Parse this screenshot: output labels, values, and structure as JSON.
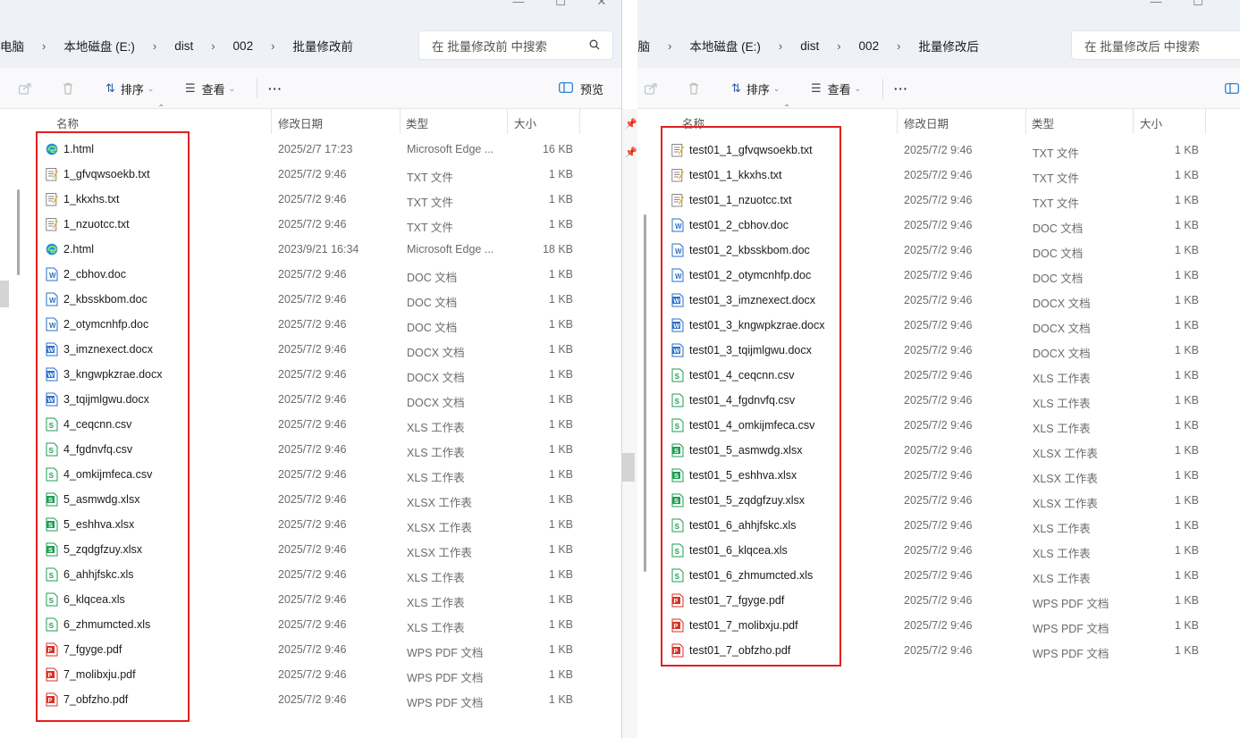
{
  "left": {
    "breadcrumb": [
      "电脑",
      "本地磁盘 (E:)",
      "dist",
      "002",
      "批量修改前"
    ],
    "search_placeholder": "在 批量修改前 中搜索",
    "toolbar": {
      "sort": "排序",
      "view": "查看",
      "more": "···",
      "preview": "预览"
    },
    "columns": {
      "name": "名称",
      "date": "修改日期",
      "type": "类型",
      "size": "大小"
    },
    "rows": [
      {
        "name": "1.html",
        "date": "2025/2/7 17:23",
        "type": "Microsoft Edge ...",
        "size": "16 KB",
        "icon": "edge"
      },
      {
        "name": "1_gfvqwsoekb.txt",
        "date": "2025/7/2 9:46",
        "type": "TXT 文件",
        "size": "1 KB",
        "icon": "txt"
      },
      {
        "name": "1_kkxhs.txt",
        "date": "2025/7/2 9:46",
        "type": "TXT 文件",
        "size": "1 KB",
        "icon": "txt"
      },
      {
        "name": "1_nzuotcc.txt",
        "date": "2025/7/2 9:46",
        "type": "TXT 文件",
        "size": "1 KB",
        "icon": "txt"
      },
      {
        "name": "2.html",
        "date": "2023/9/21 16:34",
        "type": "Microsoft Edge ...",
        "size": "18 KB",
        "icon": "edge"
      },
      {
        "name": "2_cbhov.doc",
        "date": "2025/7/2 9:46",
        "type": "DOC 文档",
        "size": "1 KB",
        "icon": "doc"
      },
      {
        "name": "2_kbsskbom.doc",
        "date": "2025/7/2 9:46",
        "type": "DOC 文档",
        "size": "1 KB",
        "icon": "doc"
      },
      {
        "name": "2_otymcnhfp.doc",
        "date": "2025/7/2 9:46",
        "type": "DOC 文档",
        "size": "1 KB",
        "icon": "doc"
      },
      {
        "name": "3_imznexect.docx",
        "date": "2025/7/2 9:46",
        "type": "DOCX 文档",
        "size": "1 KB",
        "icon": "docx"
      },
      {
        "name": "3_kngwpkzrae.docx",
        "date": "2025/7/2 9:46",
        "type": "DOCX 文档",
        "size": "1 KB",
        "icon": "docx"
      },
      {
        "name": "3_tqijmlgwu.docx",
        "date": "2025/7/2 9:46",
        "type": "DOCX 文档",
        "size": "1 KB",
        "icon": "docx"
      },
      {
        "name": "4_ceqcnn.csv",
        "date": "2025/7/2 9:46",
        "type": "XLS 工作表",
        "size": "1 KB",
        "icon": "xls"
      },
      {
        "name": "4_fgdnvfq.csv",
        "date": "2025/7/2 9:46",
        "type": "XLS 工作表",
        "size": "1 KB",
        "icon": "xls"
      },
      {
        "name": "4_omkijmfeca.csv",
        "date": "2025/7/2 9:46",
        "type": "XLS 工作表",
        "size": "1 KB",
        "icon": "xls"
      },
      {
        "name": "5_asmwdg.xlsx",
        "date": "2025/7/2 9:46",
        "type": "XLSX 工作表",
        "size": "1 KB",
        "icon": "xlsx"
      },
      {
        "name": "5_eshhva.xlsx",
        "date": "2025/7/2 9:46",
        "type": "XLSX 工作表",
        "size": "1 KB",
        "icon": "xlsx"
      },
      {
        "name": "5_zqdgfzuy.xlsx",
        "date": "2025/7/2 9:46",
        "type": "XLSX 工作表",
        "size": "1 KB",
        "icon": "xlsx"
      },
      {
        "name": "6_ahhjfskc.xls",
        "date": "2025/7/2 9:46",
        "type": "XLS 工作表",
        "size": "1 KB",
        "icon": "xls"
      },
      {
        "name": "6_klqcea.xls",
        "date": "2025/7/2 9:46",
        "type": "XLS 工作表",
        "size": "1 KB",
        "icon": "xls"
      },
      {
        "name": "6_zhmumcted.xls",
        "date": "2025/7/2 9:46",
        "type": "XLS 工作表",
        "size": "1 KB",
        "icon": "xls"
      },
      {
        "name": "7_fgyge.pdf",
        "date": "2025/7/2 9:46",
        "type": "WPS PDF 文档",
        "size": "1 KB",
        "icon": "pdf"
      },
      {
        "name": "7_molibxju.pdf",
        "date": "2025/7/2 9:46",
        "type": "WPS PDF 文档",
        "size": "1 KB",
        "icon": "pdf"
      },
      {
        "name": "7_obfzho.pdf",
        "date": "2025/7/2 9:46",
        "type": "WPS PDF 文档",
        "size": "1 KB",
        "icon": "pdf"
      }
    ]
  },
  "right": {
    "breadcrumb": [
      "电脑",
      "本地磁盘 (E:)",
      "dist",
      "002",
      "批量修改后"
    ],
    "search_placeholder": "在 批量修改后 中搜索",
    "toolbar": {
      "sort": "排序",
      "view": "查看",
      "more": "···"
    },
    "columns": {
      "name": "名称",
      "date": "修改日期",
      "type": "类型",
      "size": "大小"
    },
    "rows": [
      {
        "name": "test01_1_gfvqwsoekb.txt",
        "date": "2025/7/2 9:46",
        "type": "TXT 文件",
        "size": "1 KB",
        "icon": "txt"
      },
      {
        "name": "test01_1_kkxhs.txt",
        "date": "2025/7/2 9:46",
        "type": "TXT 文件",
        "size": "1 KB",
        "icon": "txt"
      },
      {
        "name": "test01_1_nzuotcc.txt",
        "date": "2025/7/2 9:46",
        "type": "TXT 文件",
        "size": "1 KB",
        "icon": "txt"
      },
      {
        "name": "test01_2_cbhov.doc",
        "date": "2025/7/2 9:46",
        "type": "DOC 文档",
        "size": "1 KB",
        "icon": "doc"
      },
      {
        "name": "test01_2_kbsskbom.doc",
        "date": "2025/7/2 9:46",
        "type": "DOC 文档",
        "size": "1 KB",
        "icon": "doc"
      },
      {
        "name": "test01_2_otymcnhfp.doc",
        "date": "2025/7/2 9:46",
        "type": "DOC 文档",
        "size": "1 KB",
        "icon": "doc"
      },
      {
        "name": "test01_3_imznexect.docx",
        "date": "2025/7/2 9:46",
        "type": "DOCX 文档",
        "size": "1 KB",
        "icon": "docx"
      },
      {
        "name": "test01_3_kngwpkzrae.docx",
        "date": "2025/7/2 9:46",
        "type": "DOCX 文档",
        "size": "1 KB",
        "icon": "docx"
      },
      {
        "name": "test01_3_tqijmlgwu.docx",
        "date": "2025/7/2 9:46",
        "type": "DOCX 文档",
        "size": "1 KB",
        "icon": "docx"
      },
      {
        "name": "test01_4_ceqcnn.csv",
        "date": "2025/7/2 9:46",
        "type": "XLS 工作表",
        "size": "1 KB",
        "icon": "xls"
      },
      {
        "name": "test01_4_fgdnvfq.csv",
        "date": "2025/7/2 9:46",
        "type": "XLS 工作表",
        "size": "1 KB",
        "icon": "xls"
      },
      {
        "name": "test01_4_omkijmfeca.csv",
        "date": "2025/7/2 9:46",
        "type": "XLS 工作表",
        "size": "1 KB",
        "icon": "xls"
      },
      {
        "name": "test01_5_asmwdg.xlsx",
        "date": "2025/7/2 9:46",
        "type": "XLSX 工作表",
        "size": "1 KB",
        "icon": "xlsx"
      },
      {
        "name": "test01_5_eshhva.xlsx",
        "date": "2025/7/2 9:46",
        "type": "XLSX 工作表",
        "size": "1 KB",
        "icon": "xlsx"
      },
      {
        "name": "test01_5_zqdgfzuy.xlsx",
        "date": "2025/7/2 9:46",
        "type": "XLSX 工作表",
        "size": "1 KB",
        "icon": "xlsx"
      },
      {
        "name": "test01_6_ahhjfskc.xls",
        "date": "2025/7/2 9:46",
        "type": "XLS 工作表",
        "size": "1 KB",
        "icon": "xls"
      },
      {
        "name": "test01_6_klqcea.xls",
        "date": "2025/7/2 9:46",
        "type": "XLS 工作表",
        "size": "1 KB",
        "icon": "xls"
      },
      {
        "name": "test01_6_zhmumcted.xls",
        "date": "2025/7/2 9:46",
        "type": "XLS 工作表",
        "size": "1 KB",
        "icon": "xls"
      },
      {
        "name": "test01_7_fgyge.pdf",
        "date": "2025/7/2 9:46",
        "type": "WPS PDF 文档",
        "size": "1 KB",
        "icon": "pdf"
      },
      {
        "name": "test01_7_molibxju.pdf",
        "date": "2025/7/2 9:46",
        "type": "WPS PDF 文档",
        "size": "1 KB",
        "icon": "pdf"
      },
      {
        "name": "test01_7_obfzho.pdf",
        "date": "2025/7/2 9:46",
        "type": "WPS PDF 文档",
        "size": "1 KB",
        "icon": "pdf"
      }
    ]
  },
  "colors": {
    "highlight_box": "#e02020",
    "chrome_bg": "#eef1f6",
    "accent": "#1a73c9"
  }
}
